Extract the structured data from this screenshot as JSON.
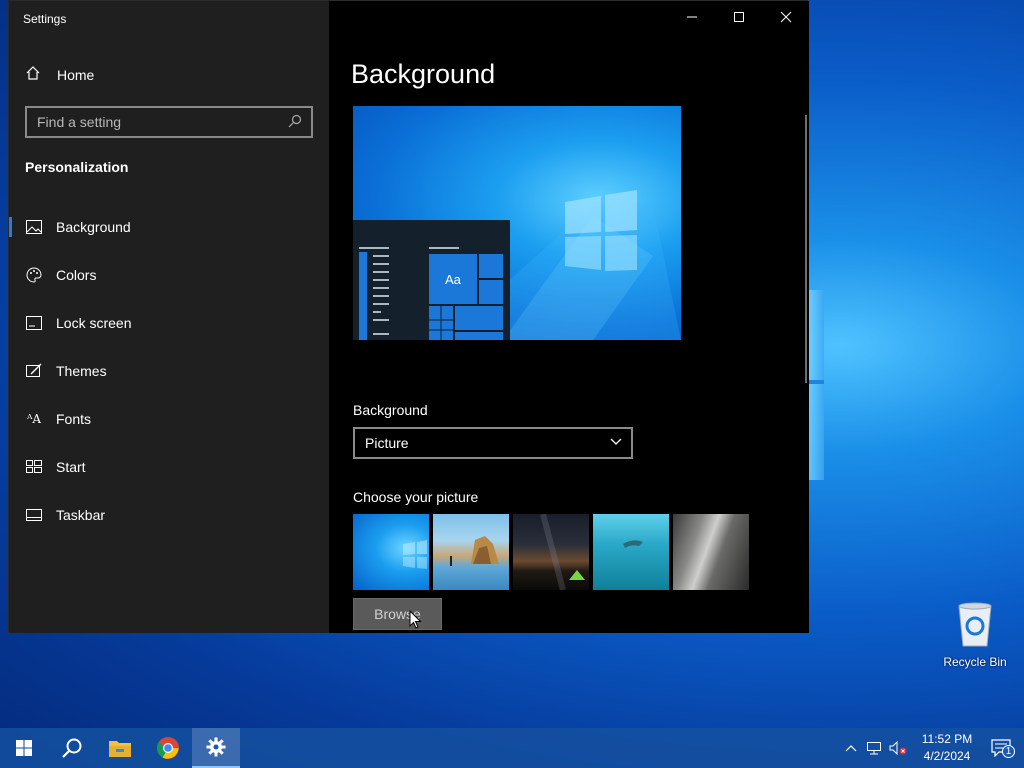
{
  "window": {
    "title": "Settings",
    "controls": {
      "minimize": "—",
      "maximize": "☐",
      "close": "✕"
    }
  },
  "sidebar": {
    "home_label": "Home",
    "search_placeholder": "Find a setting",
    "section_title": "Personalization",
    "items": [
      {
        "label": "Background",
        "icon": "picture-icon",
        "active": true
      },
      {
        "label": "Colors",
        "icon": "palette-icon",
        "active": false
      },
      {
        "label": "Lock screen",
        "icon": "lock-screen-icon",
        "active": false
      },
      {
        "label": "Themes",
        "icon": "themes-icon",
        "active": false
      },
      {
        "label": "Fonts",
        "icon": "fonts-icon",
        "active": false
      },
      {
        "label": "Start",
        "icon": "start-icon",
        "active": false
      },
      {
        "label": "Taskbar",
        "icon": "taskbar-icon",
        "active": false
      }
    ]
  },
  "main": {
    "page_title": "Background",
    "preview_sample_text": "Aa",
    "background_label": "Background",
    "background_value": "Picture",
    "choose_label": "Choose your picture",
    "browse_label": "Browse"
  },
  "desktop": {
    "recycle_bin_label": "Recycle Bin"
  },
  "taskbar": {
    "time": "11:52 PM",
    "date": "4/2/2024",
    "notification_count": "1"
  },
  "colors": {
    "accent": "#2a7ad8",
    "sidebar_bg": "#1f1f1f",
    "content_bg": "#000000"
  }
}
